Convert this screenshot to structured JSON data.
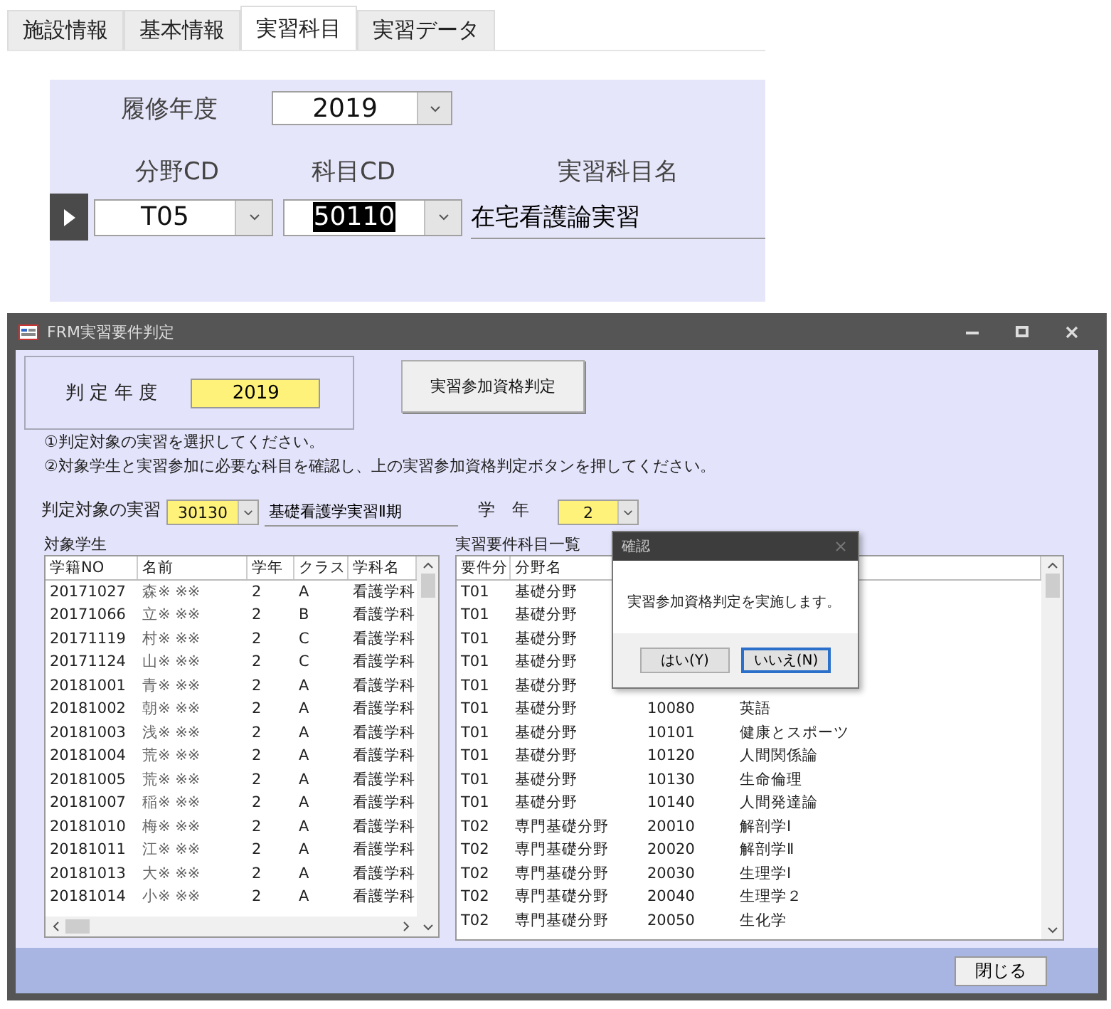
{
  "form_tabs": [
    {
      "label": "施設情報",
      "selected": false
    },
    {
      "label": "基本情報",
      "selected": false
    },
    {
      "label": "実習科目",
      "selected": true
    },
    {
      "label": "実習データ",
      "selected": false
    }
  ],
  "subject_form": {
    "year_label": "履修年度",
    "year_value": "2019",
    "column_headers": [
      "分野CD",
      "科目CD",
      "実習科目名"
    ],
    "record": {
      "field_cd": "T05",
      "subject_cd": "50110",
      "subject_cd_selected": true,
      "subject_name": "在宅看護論実習"
    }
  },
  "window": {
    "title": "FRM実習要件判定"
  },
  "judge_year": {
    "label": "判 定 年 度",
    "value": "2019"
  },
  "judge_button": "実習参加資格判定",
  "instructions": [
    "①判定対象の実習を選択してください。",
    "②対象学生と実習参加に必要な科目を確認し、上の実習参加資格判定ボタンを押してください。"
  ],
  "target": {
    "label": "判定対象の実習",
    "code": "30130",
    "name": "基礎看護学実習Ⅱ期"
  },
  "grade": {
    "label": "学　年",
    "value": "2"
  },
  "students": {
    "title": "対象学生",
    "columns": [
      "学籍NO",
      "名前",
      "学年",
      "クラス",
      "学科名"
    ],
    "rows": [
      [
        "20171027",
        "森※ ※※",
        "2",
        "A",
        "看護学科"
      ],
      [
        "20171066",
        "立※ ※※",
        "2",
        "B",
        "看護学科"
      ],
      [
        "20171119",
        "村※ ※※",
        "2",
        "C",
        "看護学科"
      ],
      [
        "20171124",
        "山※ ※※",
        "2",
        "C",
        "看護学科"
      ],
      [
        "20181001",
        "青※ ※※",
        "2",
        "A",
        "看護学科"
      ],
      [
        "20181002",
        "朝※ ※※",
        "2",
        "A",
        "看護学科"
      ],
      [
        "20181003",
        "浅※ ※※",
        "2",
        "A",
        "看護学科"
      ],
      [
        "20181004",
        "荒※ ※※",
        "2",
        "A",
        "看護学科"
      ],
      [
        "20181005",
        "荒※ ※※",
        "2",
        "A",
        "看護学科"
      ],
      [
        "20181007",
        "稲※ ※※",
        "2",
        "A",
        "看護学科"
      ],
      [
        "20181010",
        "梅※ ※※",
        "2",
        "A",
        "看護学科"
      ],
      [
        "20181011",
        "江※ ※※",
        "2",
        "A",
        "看護学科"
      ],
      [
        "20181013",
        "大※ ※※",
        "2",
        "A",
        "看護学科"
      ],
      [
        "20181014",
        "小※ ※※",
        "2",
        "A",
        "看護学科"
      ]
    ]
  },
  "requirements": {
    "title": "実習要件科目一覧",
    "columns": [
      "要件分",
      "分野名"
    ],
    "rows": [
      {
        "group": "T01",
        "field": "基礎分野"
      },
      {
        "group": "T01",
        "field": "基礎分野"
      },
      {
        "group": "T01",
        "field": "基礎分野"
      },
      {
        "group": "T01",
        "field": "基礎分野"
      },
      {
        "group": "T01",
        "field": "基礎分野"
      },
      {
        "group": "T01",
        "field": "基礎分野",
        "code": "10080",
        "name": "英語"
      },
      {
        "group": "T01",
        "field": "基礎分野",
        "code": "10101",
        "name": "健康とスポーツ"
      },
      {
        "group": "T01",
        "field": "基礎分野",
        "code": "10120",
        "name": "人間関係論"
      },
      {
        "group": "T01",
        "field": "基礎分野",
        "code": "10130",
        "name": "生命倫理"
      },
      {
        "group": "T01",
        "field": "基礎分野",
        "code": "10140",
        "name": "人間発達論"
      },
      {
        "group": "T02",
        "field": "専門基礎分野",
        "code": "20010",
        "name": "解剖学Ⅰ"
      },
      {
        "group": "T02",
        "field": "専門基礎分野",
        "code": "20020",
        "name": "解剖学Ⅱ"
      },
      {
        "group": "T02",
        "field": "専門基礎分野",
        "code": "20030",
        "name": "生理学Ⅰ"
      },
      {
        "group": "T02",
        "field": "専門基礎分野",
        "code": "20040",
        "name": "生理学２"
      },
      {
        "group": "T02",
        "field": "専門基礎分野",
        "code": "20050",
        "name": "生化学"
      }
    ]
  },
  "dialog": {
    "title": "確認",
    "message": "実習参加資格判定を実施します。",
    "buttons": [
      {
        "label": "はい(Y)",
        "selected": false
      },
      {
        "label": "いいえ(N)",
        "selected": true
      }
    ]
  },
  "close_button": "閉じる"
}
